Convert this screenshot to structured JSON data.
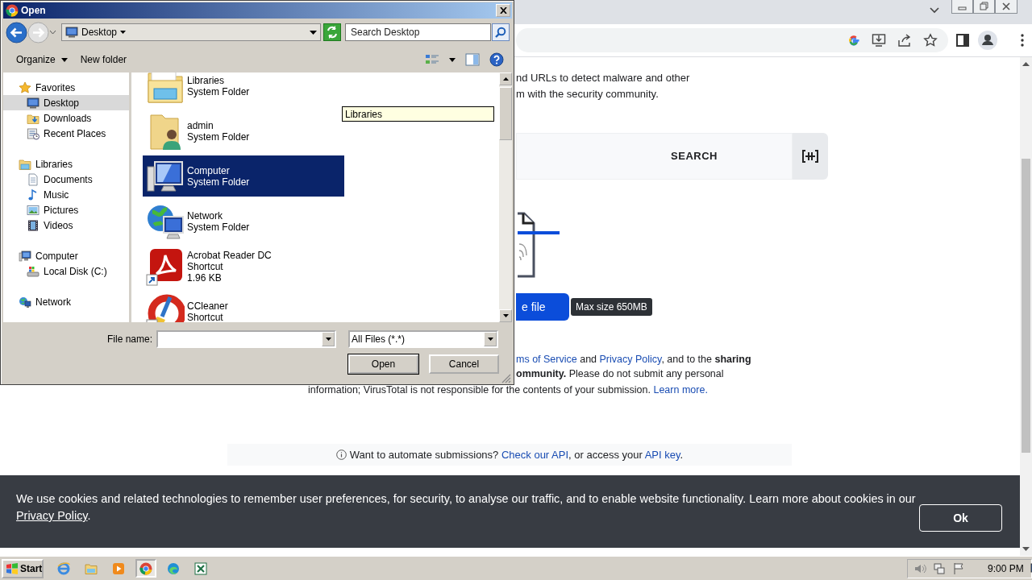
{
  "browser": {
    "page": {
      "intro_lines": [
        "nd URLs to detect malware and other",
        "m with the security community."
      ],
      "tabs": [
        {
          "label": "SEARCH",
          "selected": false
        }
      ],
      "upload_button": "e file",
      "upload_hint": "Max size 650MB",
      "terms_lines": [
        [
          {
            "kind": "link",
            "text": "ms of Service"
          },
          {
            "kind": "text",
            "text": " and "
          },
          {
            "kind": "link",
            "text": "Privacy Policy"
          },
          {
            "kind": "text",
            "text": ", and to the "
          },
          {
            "kind": "bold",
            "text": "sharing"
          }
        ],
        [
          {
            "kind": "bold",
            "text": "ommunity."
          },
          {
            "kind": "text",
            "text": " Please do not submit any personal"
          }
        ],
        [
          {
            "kind": "text",
            "text": "information; VirusTotal is not responsible for the contents of your submission. "
          },
          {
            "kind": "link",
            "text": "Learn more."
          }
        ]
      ],
      "api_note": [
        {
          "kind": "text",
          "text": "Want to automate submissions? "
        },
        {
          "kind": "link",
          "text": "Check our API"
        },
        {
          "kind": "text",
          "text": ", or access your "
        },
        {
          "kind": "link",
          "text": "API key"
        },
        {
          "kind": "text",
          "text": "."
        }
      ],
      "cookie_banner": {
        "lines": [
          [
            {
              "kind": "text",
              "text": "We use cookies and related technologies to remember user preferences, for security, to analyse our traffic, and to enable website functionality. Learn more about cookies in our"
            }
          ],
          [
            {
              "kind": "link",
              "text": "Privacy Policy"
            },
            {
              "kind": "text",
              "text": "."
            }
          ]
        ],
        "button": "Ok"
      }
    }
  },
  "dialog": {
    "title": "Open",
    "location": "Desktop",
    "search": {
      "placeholder": "Search Desktop"
    },
    "toolbar": [
      {
        "label": "Organize",
        "kind": "menu"
      },
      {
        "label": "New folder",
        "kind": "button"
      }
    ],
    "nav_pane": [
      {
        "label": "Favorites",
        "kind": "favorites",
        "selected": false,
        "children": [
          {
            "label": "Desktop",
            "kind": "desktop",
            "selected": true
          },
          {
            "label": "Downloads",
            "kind": "downloads",
            "selected": false
          },
          {
            "label": "Recent Places",
            "kind": "recent",
            "selected": false
          }
        ]
      },
      {
        "label": "Libraries",
        "kind": "libraries",
        "selected": false,
        "children": [
          {
            "label": "Documents",
            "kind": "documents",
            "selected": false
          },
          {
            "label": "Music",
            "kind": "music",
            "selected": false
          },
          {
            "label": "Pictures",
            "kind": "pictures",
            "selected": false
          },
          {
            "label": "Videos",
            "kind": "videos",
            "selected": false
          }
        ]
      },
      {
        "label": "Computer",
        "kind": "computer",
        "selected": false,
        "children": [
          {
            "label": "Local Disk (C:)",
            "kind": "disk",
            "selected": false
          }
        ]
      },
      {
        "label": "Network",
        "kind": "network",
        "selected": false
      }
    ],
    "files": [
      {
        "name": "Libraries",
        "details": [
          "System Folder"
        ],
        "kind": "libraries",
        "selected": false
      },
      {
        "name": "admin",
        "details": [
          "System Folder"
        ],
        "kind": "user-folder",
        "selected": false
      },
      {
        "name": "Computer",
        "details": [
          "System Folder"
        ],
        "kind": "computer",
        "selected": true
      },
      {
        "name": "Network",
        "details": [
          "System Folder"
        ],
        "kind": "network",
        "selected": false
      },
      {
        "name": "Acrobat Reader DC",
        "details": [
          "Shortcut",
          "1.96 KB"
        ],
        "kind": "pdf-shortcut",
        "selected": false
      },
      {
        "name": "CCleaner",
        "details": [
          "Shortcut"
        ],
        "kind": "cleaner-shortcut",
        "selected": false
      }
    ],
    "tooltip": "Libraries",
    "file_name_label": "File name:",
    "file_type": "All Files (*.*)",
    "buttons": [
      {
        "label": "Open",
        "default": true
      },
      {
        "label": "Cancel",
        "default": false
      }
    ]
  },
  "taskbar": {
    "start": "Start",
    "apps": [
      {
        "kind": "ie",
        "selected": false
      },
      {
        "kind": "explorer",
        "selected": false
      },
      {
        "kind": "media",
        "selected": false
      },
      {
        "kind": "chrome",
        "selected": true
      },
      {
        "kind": "edge",
        "selected": false
      },
      {
        "kind": "excel",
        "selected": false
      }
    ],
    "clock": "9:00 PM"
  }
}
